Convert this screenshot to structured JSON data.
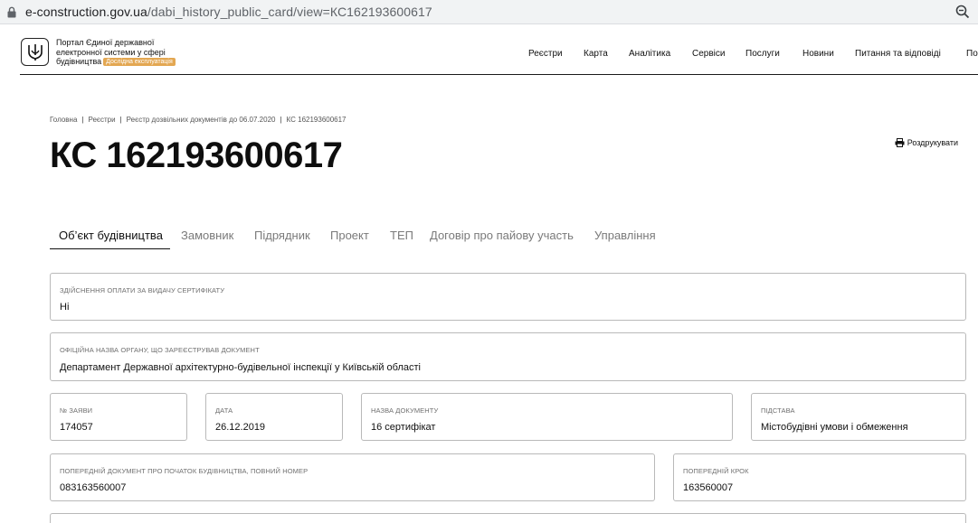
{
  "browser": {
    "url_host": "e-construction.gov.ua",
    "url_path": "/dabi_history_public_card/view=КС162193600617"
  },
  "header": {
    "portal_line1": "Портал Єдиної державної",
    "portal_line2": "електронної системи у сфері",
    "portal_line3": "будівництва",
    "beta_badge": "Дослідна експлуатація",
    "nav": [
      "Реєстри",
      "Карта",
      "Аналітика",
      "Сервіси",
      "Послуги",
      "Новини",
      "Питання та відповіді",
      "По"
    ]
  },
  "breadcrumbs": [
    "Головна",
    "Реєстри",
    "Реєстр дозвільних документів до 06.07.2020",
    "КС 162193600617"
  ],
  "title": "КС 162193600617",
  "print_label": "Роздрукувати",
  "tabs": [
    "Об’єкт будівництва",
    "Замовник",
    "Підрядник",
    "Проект",
    "ТЕП",
    "Договір про пайову участь",
    "Управління"
  ],
  "fields": {
    "payment": {
      "label": "Здійснення оплати за видачу сертифікату",
      "value": "Ні"
    },
    "authority": {
      "label": "Офіційна назва органу, що зареєстрував документ",
      "value": "Департамент Державної архітектурно-будівельної інспекції у Київській області"
    },
    "app_no": {
      "label": "№ заяви",
      "value": "174057"
    },
    "date": {
      "label": "Дата",
      "value": "26.12.2019"
    },
    "doc_name": {
      "label": "Назва документу",
      "value": "16 сертифікат"
    },
    "basis": {
      "label": "Підстава",
      "value": "Містобудівні умови і обмеження"
    },
    "prev_doc": {
      "label": "Попередній документ про початок будівництва, повний номер",
      "value": "083163560007"
    },
    "prev_step": {
      "label": "Попередній крок",
      "value": "163560007"
    }
  },
  "colors": {
    "accent_badge": "#e3a752",
    "border": "#b9b9b9",
    "text": "#111111",
    "muted": "#7a7a7a"
  }
}
